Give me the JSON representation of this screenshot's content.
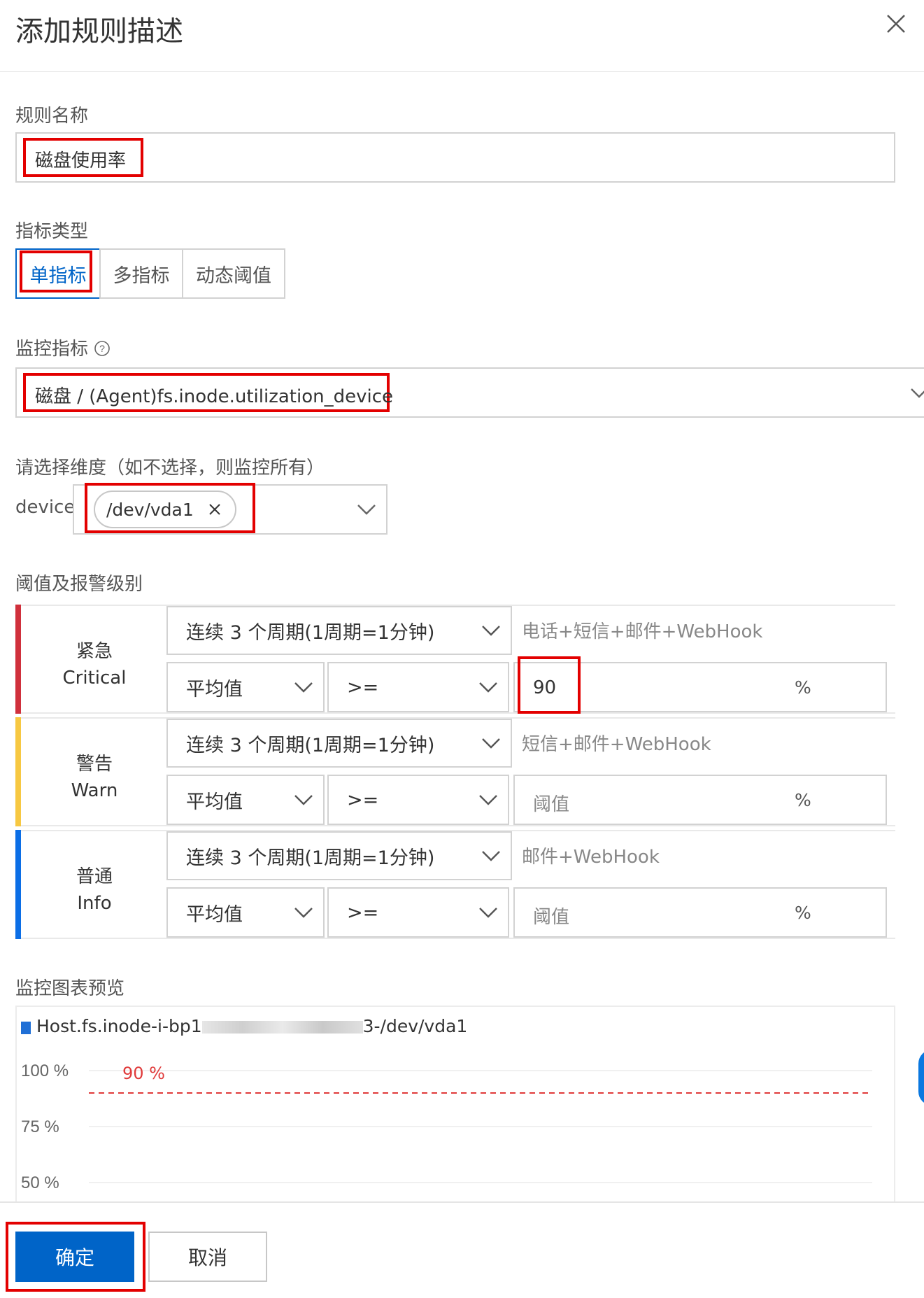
{
  "dialog": {
    "title": "添加规则描述"
  },
  "rule_name": {
    "label": "规则名称",
    "value": "磁盘使用率"
  },
  "metric_type": {
    "label": "指标类型",
    "options": [
      "单指标",
      "多指标",
      "动态阈值"
    ],
    "selected": "单指标"
  },
  "monitor_metric": {
    "label": "监控指标",
    "value": "磁盘 / (Agent)fs.inode.utilization_device"
  },
  "dimension": {
    "label": "请选择维度（如不选择，则监控所有）",
    "key": "device:",
    "tag": "/dev/vda1"
  },
  "thresholds": {
    "label": "阈值及报警级别",
    "levels": [
      {
        "name": "紧急",
        "name_en": "Critical",
        "color": "#d0303c",
        "period": "连续 3 个周期(1周期=1分钟)",
        "notify": "电话+短信+邮件+WebHook",
        "stat": "平均值",
        "op": ">=",
        "value": "90",
        "unit": "%"
      },
      {
        "name": "警告",
        "name_en": "Warn",
        "color": "#f7c842",
        "period": "连续 3 个周期(1周期=1分钟)",
        "notify": "短信+邮件+WebHook",
        "stat": "平均值",
        "op": ">=",
        "placeholder": "阈值",
        "unit": "%"
      },
      {
        "name": "普通",
        "name_en": "Info",
        "color": "#0b6ee6",
        "period": "连续 3 个周期(1周期=1分钟)",
        "notify": "邮件+WebHook",
        "stat": "平均值",
        "op": ">=",
        "placeholder": "阈值",
        "unit": "%"
      }
    ]
  },
  "chart_preview": {
    "label": "监控图表预览",
    "series_label": "Host.fs.inode-i-bp1",
    "series_suffix": "3-/dev/vda1",
    "threshold_label": "90 %"
  },
  "chart_data": {
    "type": "line",
    "series": [
      {
        "name": "Host.fs.inode-i-bp1…3-/dev/vda1",
        "values": []
      }
    ],
    "threshold": 90,
    "y_ticks": [
      "100 %",
      "75 %",
      "50 %"
    ],
    "ylim": [
      50,
      100
    ],
    "grid": true,
    "colors": {
      "series": "#1f6fd6",
      "threshold": "#e03a3a"
    }
  },
  "footer": {
    "confirm": "确定",
    "cancel": "取消"
  },
  "colors": {
    "primary": "#0064c8",
    "highlight": "#e30000"
  }
}
